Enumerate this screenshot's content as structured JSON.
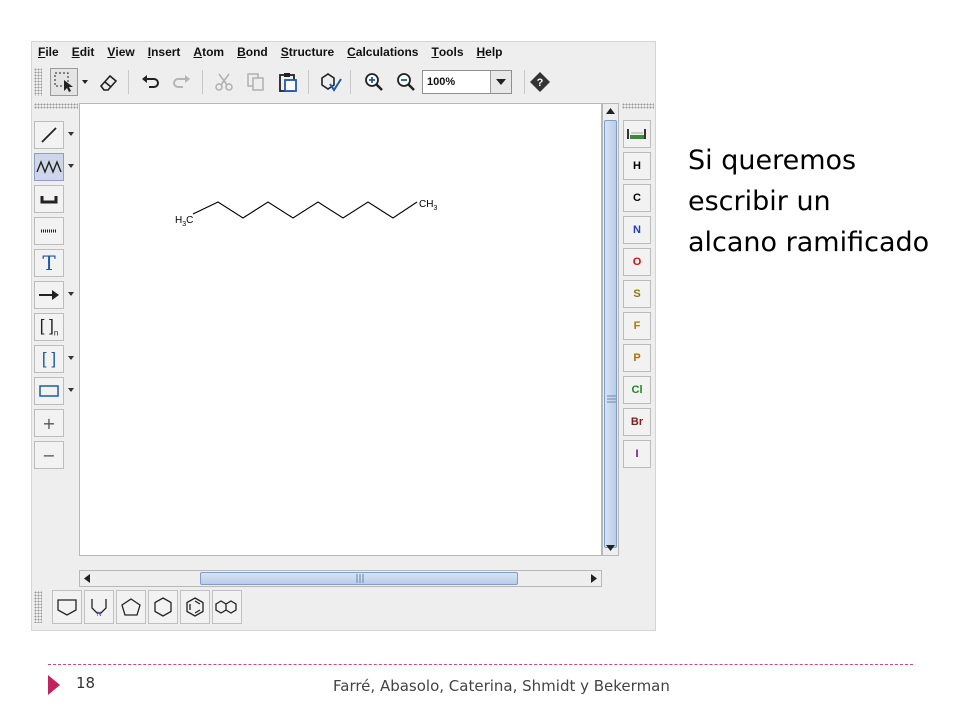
{
  "menu": {
    "items": [
      {
        "key": "F",
        "rest": "ile"
      },
      {
        "key": "E",
        "rest": "dit"
      },
      {
        "key": "V",
        "rest": "iew"
      },
      {
        "key": "I",
        "rest": "nsert"
      },
      {
        "key": "A",
        "rest": "tom"
      },
      {
        "key": "B",
        "rest": "ond"
      },
      {
        "key": "S",
        "rest": "tructure"
      },
      {
        "key": "C",
        "rest": "alculations"
      },
      {
        "key": "T",
        "rest": "ools"
      },
      {
        "key": "H",
        "rest": "elp"
      }
    ]
  },
  "toolbar": {
    "zoom_value": "100%",
    "icons": [
      "selection-icon",
      "eraser-icon",
      "undo-icon",
      "redo-icon",
      "cut-icon",
      "copy-icon",
      "paste-icon",
      "clean-icon",
      "zoom-in-icon",
      "zoom-out-icon",
      "help-icon"
    ]
  },
  "left_tools": {
    "text_tool_label": "T",
    "bracket_n_label": "[ ]",
    "bracket_n_sub": "n",
    "bracket_label": "[ ]",
    "charge_plus": "+",
    "charge_minus": "−"
  },
  "molecule": {
    "left_label": {
      "main": "H",
      "sub": "3",
      "tail": "C"
    },
    "right_label": {
      "main": "CH",
      "sub": "3"
    }
  },
  "elements": [
    {
      "symbol": "H",
      "color": "#000000"
    },
    {
      "symbol": "C",
      "color": "#000000"
    },
    {
      "symbol": "N",
      "color": "#1f3fc0"
    },
    {
      "symbol": "O",
      "color": "#d01010"
    },
    {
      "symbol": "S",
      "color": "#8c7a00"
    },
    {
      "symbol": "F",
      "color": "#b07800"
    },
    {
      "symbol": "P",
      "color": "#b07000"
    },
    {
      "symbol": "Cl",
      "color": "#1a8a1a"
    },
    {
      "symbol": "Br",
      "color": "#7a2020"
    },
    {
      "symbol": "I",
      "color": "#6a1a9a"
    }
  ],
  "templates": {
    "pyrrolidine_atom": "N"
  },
  "slide": {
    "lines": [
      "Si queremos",
      "escribir un",
      "alcano ramificado"
    ]
  },
  "footer": {
    "page_number": "18",
    "authors": "Farré, Abasolo, Caterina, Shmidt y Bekerman",
    "accent_color": "#c0235f"
  }
}
